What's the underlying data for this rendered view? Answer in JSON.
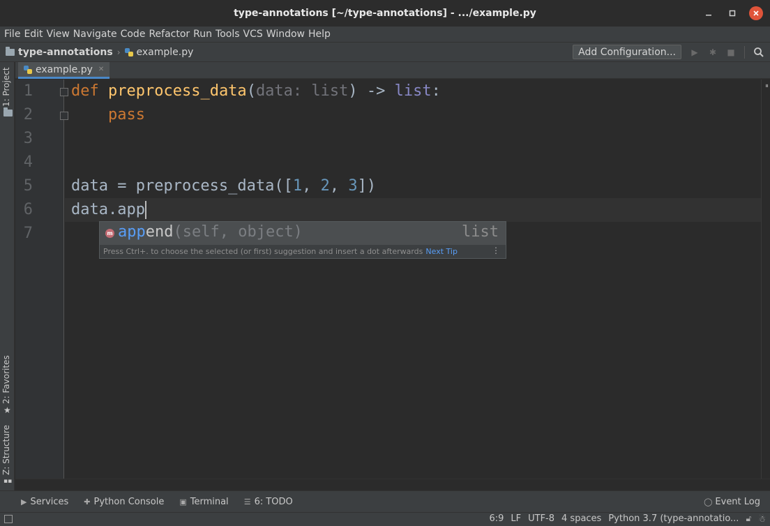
{
  "window": {
    "title": "type-annotations [~/type-annotations] - .../example.py"
  },
  "menu": [
    "File",
    "Edit",
    "View",
    "Navigate",
    "Code",
    "Refactor",
    "Run",
    "Tools",
    "VCS",
    "Window",
    "Help"
  ],
  "breadcrumb": {
    "project": "type-annotations",
    "file": "example.py"
  },
  "toolbar": {
    "add_configuration": "Add Configuration..."
  },
  "side_tools": {
    "project": "1: Project",
    "favorites": "2: Favorites",
    "structure": "Z: Structure"
  },
  "tabs": [
    {
      "label": "example.py",
      "active": true
    }
  ],
  "editor": {
    "line_numbers": [
      "1",
      "2",
      "3",
      "4",
      "5",
      "6",
      "7"
    ],
    "line1": {
      "kw": "def",
      "fn": "preprocess_data",
      "p_open": "(",
      "param": "data",
      "colon": ":",
      "ptype": "list",
      "p_close": ")",
      "arrow": "->",
      "rtype": "list",
      "end": ":"
    },
    "line2": {
      "kw": "pass"
    },
    "line5": {
      "a": "data = preprocess_data([",
      "n1": "1",
      "c1": ", ",
      "n2": "2",
      "c2": ", ",
      "n3": "3",
      "b": "])"
    },
    "line6": {
      "text": "data.app"
    },
    "cursor_line": 6
  },
  "completion": {
    "icon_letter": "m",
    "match": "app",
    "rest": "end",
    "signature": "(self, object)",
    "type": "list",
    "tip": "Press Ctrl+. to choose the selected (or first) suggestion and insert a dot afterwards",
    "next_tip": "Next Tip"
  },
  "bottom_tools": {
    "services": "Services",
    "python_console": "Python Console",
    "terminal": "Terminal",
    "todo": "6: TODO",
    "event_log": "Event Log"
  },
  "status": {
    "position": "6:9",
    "line_sep": "LF",
    "encoding": "UTF-8",
    "indent": "4 spaces",
    "interpreter": "Python 3.7 (type-annotatio..."
  },
  "colors": {
    "keyword": "#cc7832",
    "function": "#ffc66d",
    "number": "#6897bb",
    "builtin_type": "#8888c6",
    "match_highlight": "#589df6",
    "close_button": "#e0543a"
  }
}
